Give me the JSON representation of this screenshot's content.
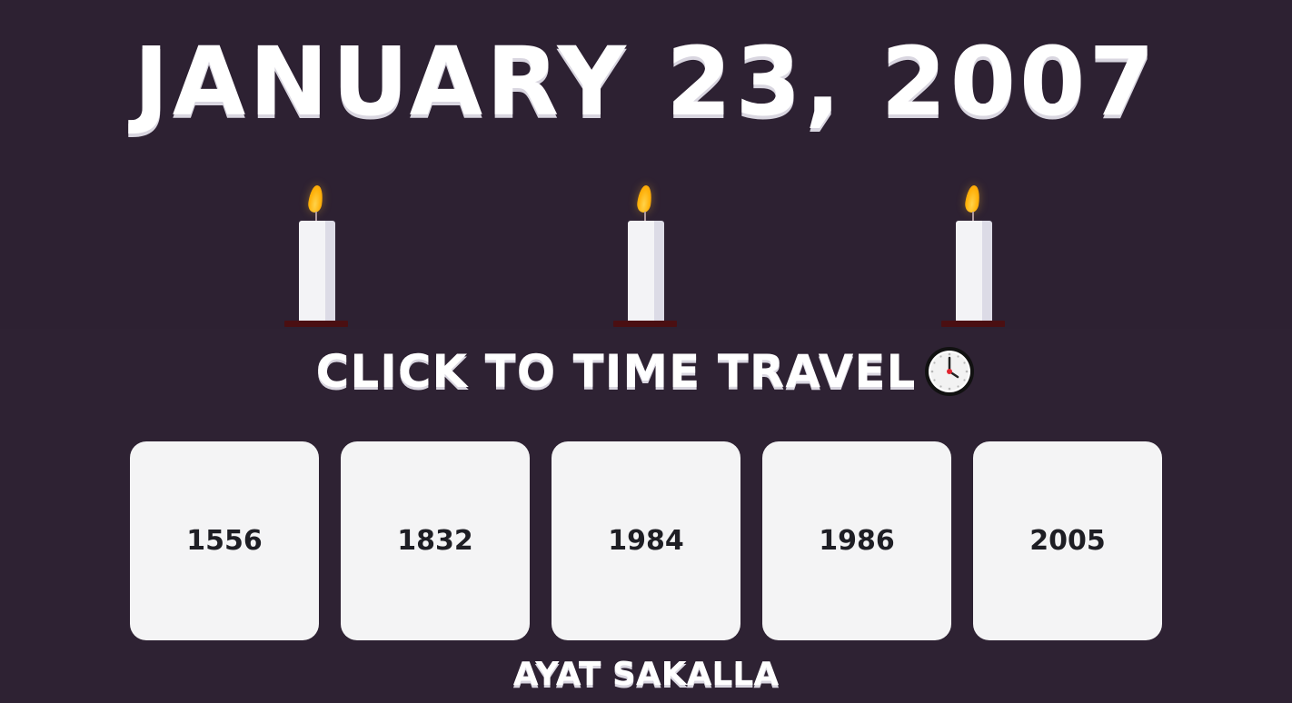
{
  "header": {
    "date": "JANUARY 23, 2007"
  },
  "candles": [
    {
      "name": "candle-left"
    },
    {
      "name": "candle-middle"
    },
    {
      "name": "candle-right"
    }
  ],
  "cta": {
    "label": "CLICK TO TIME TRAVEL",
    "icon": "clock-icon"
  },
  "years": [
    "1556",
    "1832",
    "1984",
    "1986",
    "2005"
  ],
  "footer": {
    "author": "AYAT SAKALLA"
  },
  "colors": {
    "background": "#2e2233",
    "card": "#f4f4f5",
    "flame": "#ffb20c",
    "candle_base": "#4a0f12"
  }
}
